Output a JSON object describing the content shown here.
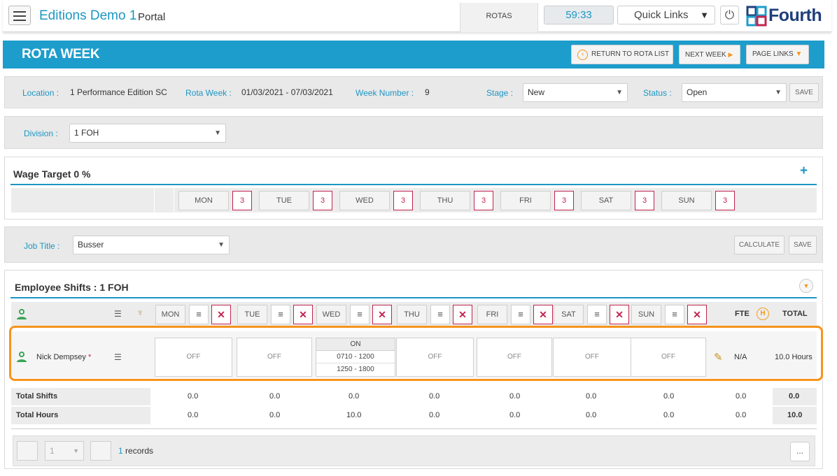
{
  "app": {
    "title": "Editions Demo 1",
    "subtitle": "Portal",
    "rotas_tab": "ROTAS",
    "timer": "59:33",
    "quick_links": "Quick Links",
    "brand": "Fourth"
  },
  "page": {
    "title": "ROTA WEEK",
    "return_btn": "RETURN TO ROTA LIST",
    "next_btn": "NEXT WEEK",
    "links_btn": "PAGE LINKS"
  },
  "info": {
    "location_label": "Location :",
    "location": "1 Performance Edition SC",
    "rotaweek_label": "Rota Week :",
    "rotaweek": "01/03/2021 - 07/03/2021",
    "weeknum_label": "Week Number :",
    "weeknum": "9",
    "stage_label": "Stage :",
    "stage": "New",
    "status_label": "Status :",
    "status": "Open",
    "save": "SAVE"
  },
  "division": {
    "label": "Division :",
    "value": "1 FOH"
  },
  "wage": {
    "title": "Wage Target 0 %",
    "plus": "+",
    "days": [
      {
        "d": "MON",
        "c": "3"
      },
      {
        "d": "TUE",
        "c": "3"
      },
      {
        "d": "WED",
        "c": "3"
      },
      {
        "d": "THU",
        "c": "3"
      },
      {
        "d": "FRI",
        "c": "3"
      },
      {
        "d": "SAT",
        "c": "3"
      },
      {
        "d": "SUN",
        "c": "3"
      }
    ]
  },
  "job": {
    "label": "Job Title :",
    "value": "Busser",
    "calculate": "CALCULATE",
    "save": "SAVE"
  },
  "shifts": {
    "title": "Employee Shifts : 1 FOH",
    "days": [
      "MON",
      "TUE",
      "WED",
      "THU",
      "FRI",
      "SAT",
      "SUN"
    ],
    "fte": "FTE",
    "h": "H",
    "total": "TOTAL",
    "employee": {
      "name": "Nick Dempsey",
      "req": "*",
      "mon": "OFF",
      "tue": "OFF",
      "wed_status": "ON",
      "wed_shift1": "0710 - 1200",
      "wed_shift2": "1250 - 1800",
      "thu": "OFF",
      "fri": "OFF",
      "sat": "OFF",
      "sun": "OFF",
      "fte": "N/A",
      "total": "10.0 Hours"
    },
    "total_shifts_label": "Total Shifts",
    "total_shifts": [
      "0.0",
      "0.0",
      "0.0",
      "0.0",
      "0.0",
      "0.0",
      "0.0"
    ],
    "total_shifts_fte": "0.0",
    "total_shifts_total": "0.0",
    "total_hours_label": "Total Hours",
    "total_hours": [
      "0.0",
      "0.0",
      "10.0",
      "0.0",
      "0.0",
      "0.0",
      "0.0"
    ],
    "total_hours_fte": "0.0",
    "total_hours_total": "10.0"
  },
  "footer": {
    "page": "1",
    "records_count": "1",
    "records_label": "records",
    "more": "..."
  },
  "colors": {
    "accent": "#1d9dcc",
    "danger": "#c22450",
    "highlight": "#f7941d"
  }
}
